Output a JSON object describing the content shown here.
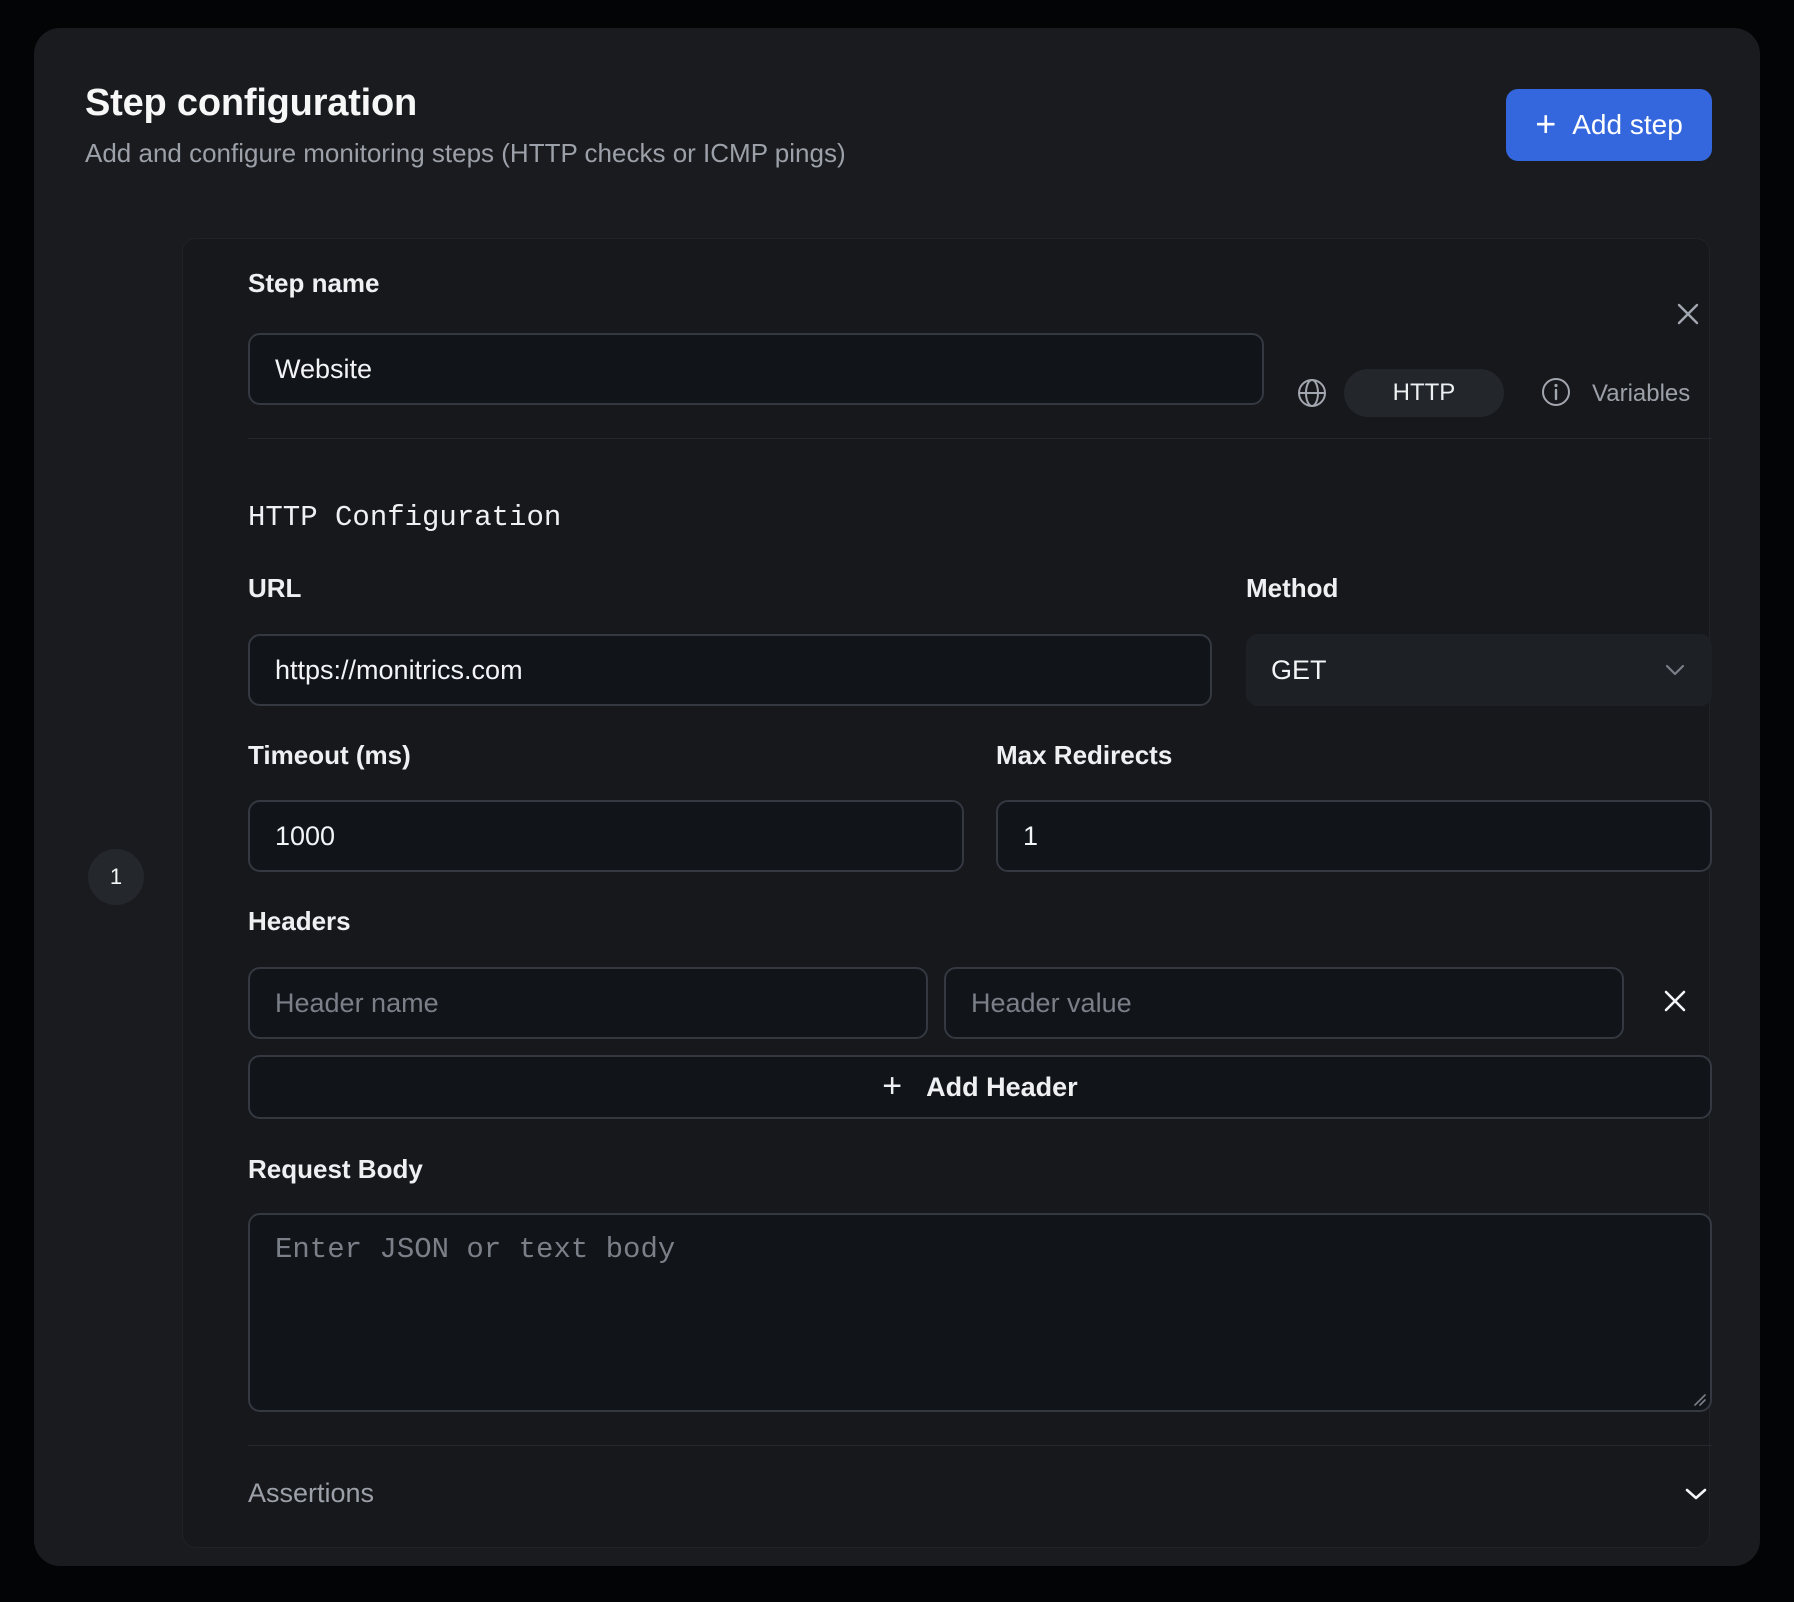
{
  "header": {
    "title": "Step configuration",
    "subtitle": "Add and configure monitoring steps (HTTP checks or ICMP pings)",
    "add_step_label": "Add step"
  },
  "step": {
    "number": "1",
    "name_label": "Step name",
    "name_value": "Website",
    "type_label": "HTTP",
    "variables_label": "Variables"
  },
  "http": {
    "section_title": "HTTP Configuration",
    "url_label": "URL",
    "url_value": "https://monitrics.com",
    "method_label": "Method",
    "method_value": "GET",
    "timeout_label": "Timeout (ms)",
    "timeout_value": "1000",
    "redirects_label": "Max Redirects",
    "redirects_value": "1",
    "headers_label": "Headers",
    "header_name_placeholder": "Header name",
    "header_value_placeholder": "Header value",
    "add_header_label": "Add Header",
    "body_label": "Request Body",
    "body_placeholder": "Enter JSON or text body",
    "assertions_label": "Assertions"
  },
  "colors": {
    "accent": "#3467dd",
    "panel": "#191b1f",
    "input_bg": "#111419",
    "input_border": "#343840"
  },
  "icons": [
    "plus-icon",
    "close-icon",
    "globe-icon",
    "info-icon",
    "chevron-down-icon"
  ]
}
